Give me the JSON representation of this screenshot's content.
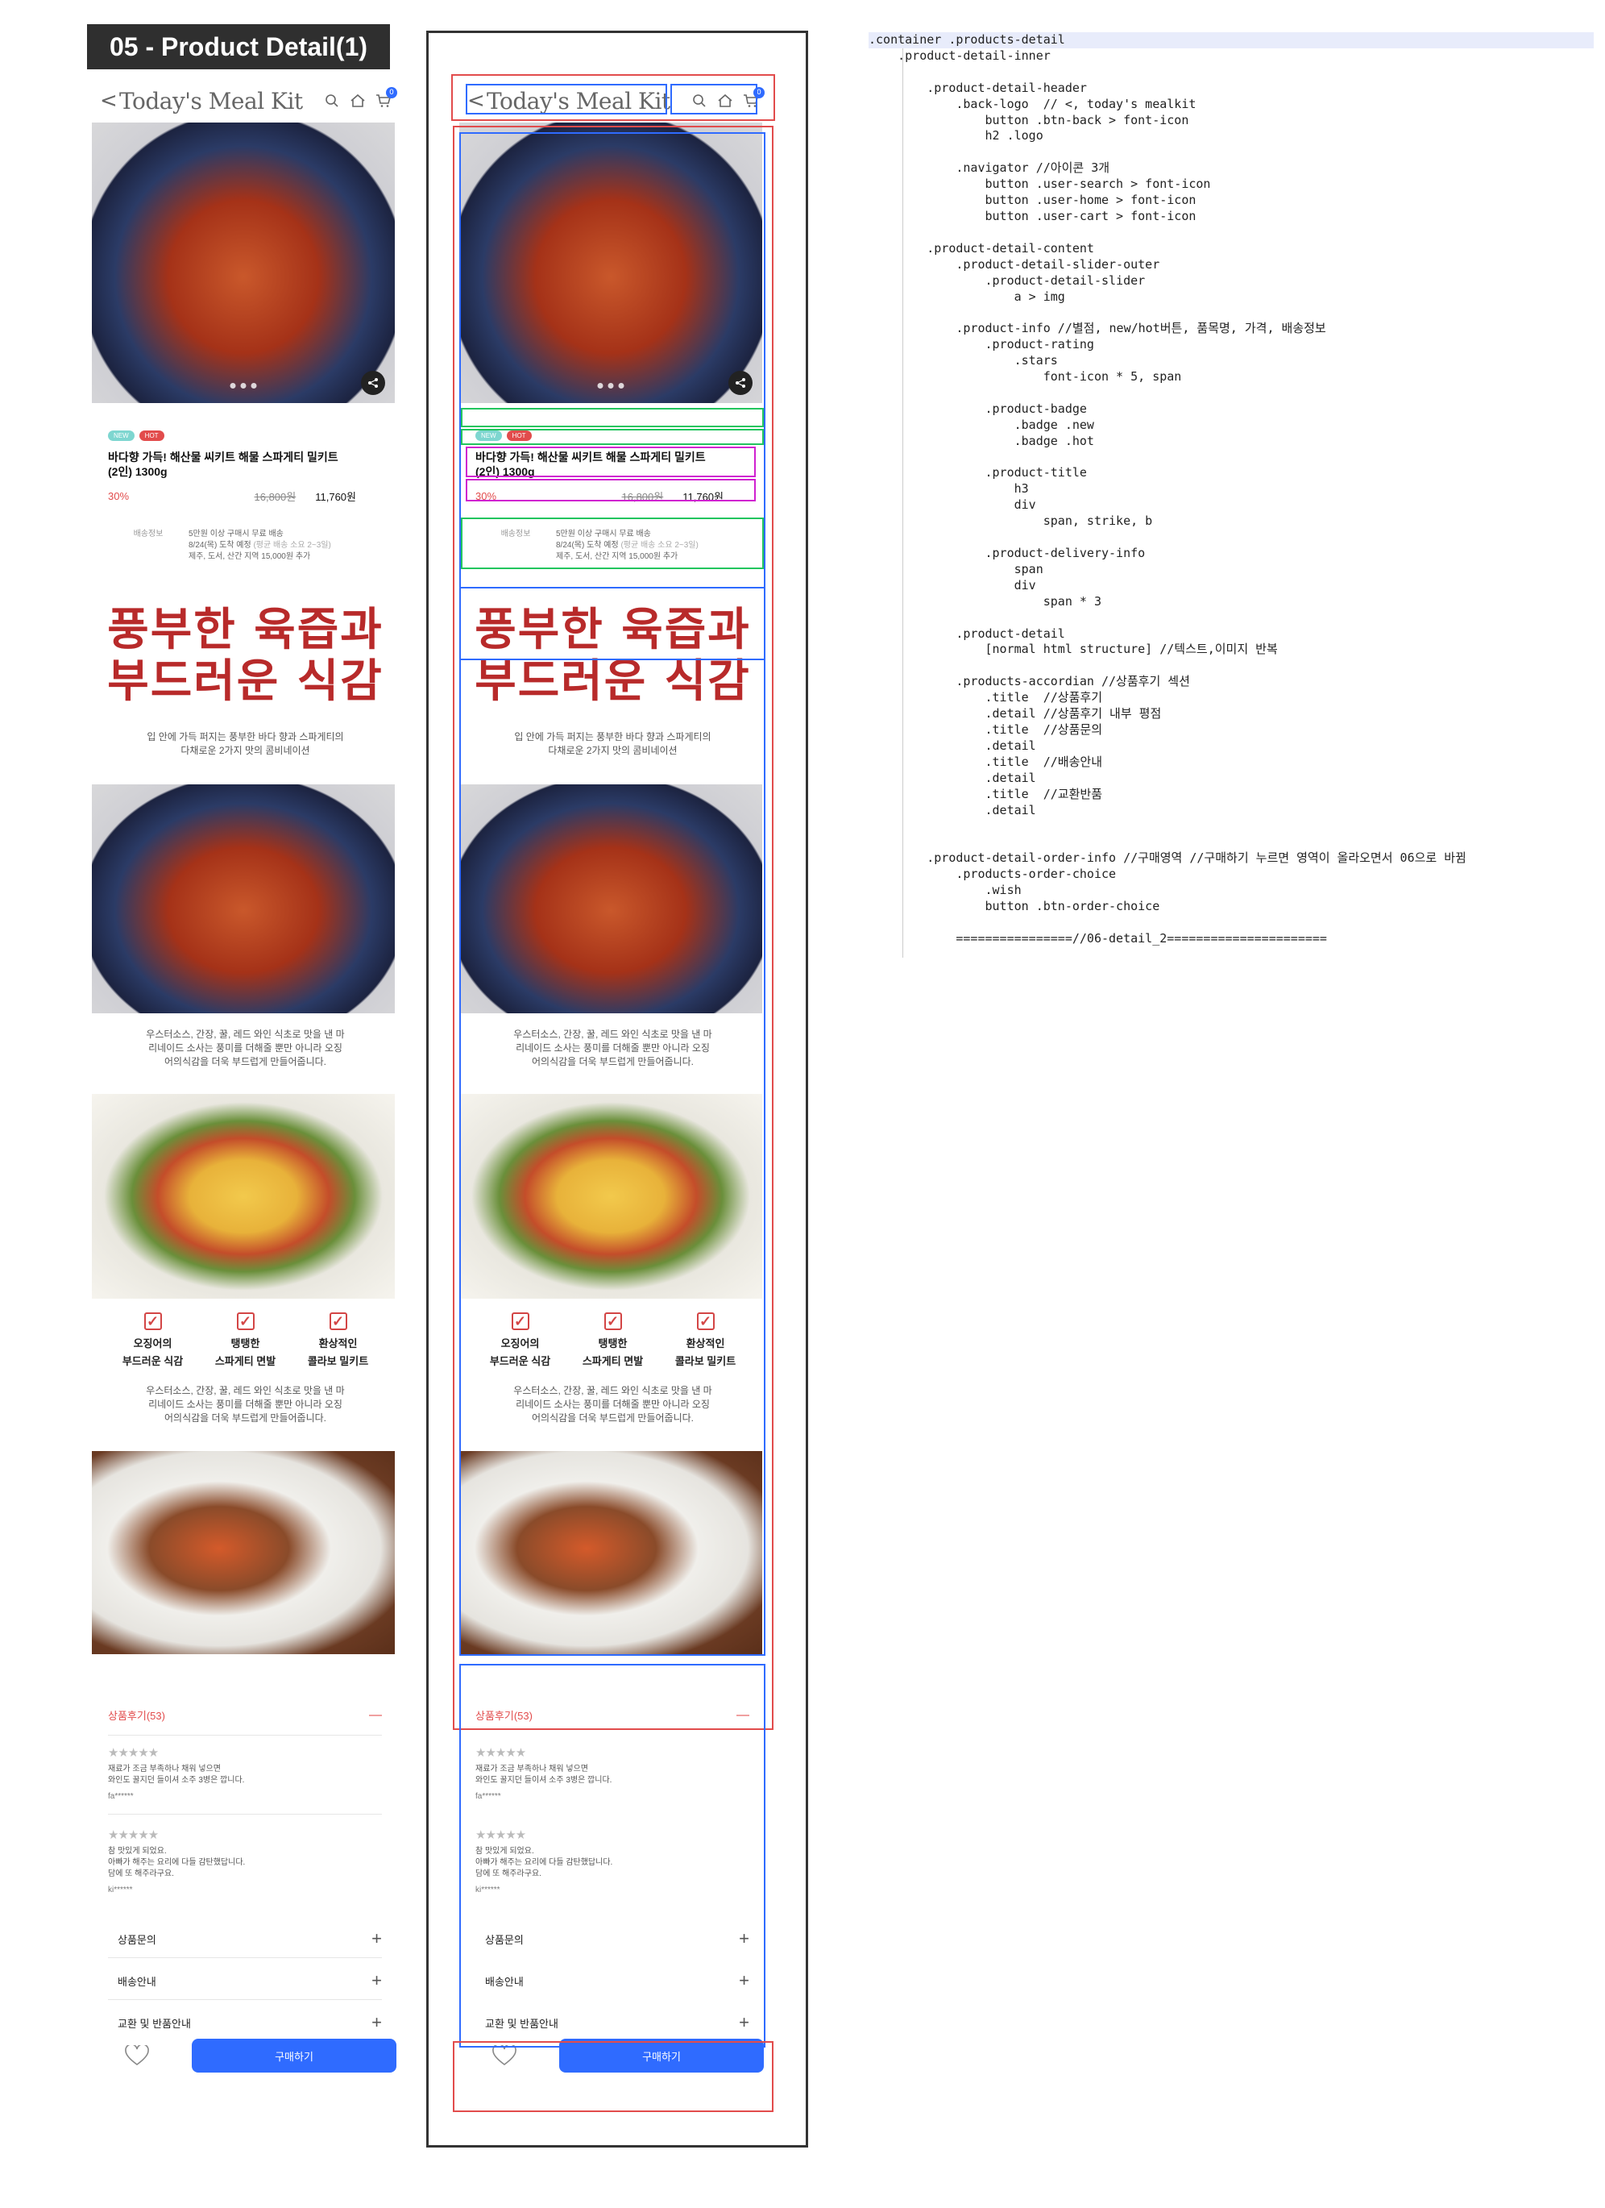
{
  "page_label": "05 - Product Detail(1)",
  "header": {
    "back_icon": "<",
    "logo": "Today's Meal Kit",
    "cart_count": "0"
  },
  "product": {
    "badge_new": "NEW",
    "badge_hot": "HOT",
    "title_line1": "바다향 가득! 해산물 씨키트 해물 스파게티 밀키트",
    "title_line2": "(2인) 1300g",
    "discount_rate": "30%",
    "original_price": "16,800원",
    "sale_price": "11,760원",
    "delivery_label": "배송정보",
    "delivery_line1": "5만원 이상 구매시 무료 배송",
    "delivery_line2a": "8/24(목) 도착 예정",
    "delivery_line2b": "(평균 배송 소요 2~3일)",
    "delivery_line3": "제주, 도서, 산간 지역 15,000원 추가"
  },
  "detail": {
    "headline_line1": "풍부한 육즙과",
    "headline_line2": "부드러운 식감",
    "para1_line1": "입 안에 가득 퍼지는 풍부한 바다 향과 스파게티의",
    "para1_line2": "다채로운 2가지 맛의 콤비네이션",
    "para2_line1": "우스터소스, 간장, 꿀, 레드 와인 식초로 맛을 낸 마",
    "para2_line2": "리네이드 소사는 풍미를 더해줄 뿐만 아니라 오징",
    "para2_line3": "어의식감을 더욱 부드럽게 만들어줍니다.",
    "checks": [
      {
        "line1": "오징어의",
        "line2": "부드러운 식감"
      },
      {
        "line1": "탱탱한",
        "line2": "스파게티 면발"
      },
      {
        "line1": "환상적인",
        "line2": "콜라보 밀키트"
      }
    ],
    "para3_line1": "우스터소스, 간장, 꿀, 레드 와인 식초로 맛을 낸 마",
    "para3_line2": "리네이드 소사는 풍미를 더해줄 뿐만 아니라 오징",
    "para3_line3": "어의식감을 더욱 부드럽게 만들어줍니다."
  },
  "accordion": {
    "reviews_title": "상품후기(53)",
    "reviews_symbol": "—",
    "reviews": [
      {
        "stars": "★★★★★",
        "line1": "재료가 조금 부족하나 채워 넣으면",
        "line2": "와인도 꿀지던 들이셔 소주 3병은 깝니다.",
        "user": "fa******"
      },
      {
        "stars": "★★★★★",
        "line1": "참 맛있게 되었요.",
        "line2": "아빠가 해주는 요리에 다들 감탄했답니다.",
        "line3": "담에 또 해주라구요.",
        "user": "ki******"
      }
    ],
    "qna_title": "상품문의",
    "shipping_title": "배송안내",
    "exchange_title": "교환 및 반품안내",
    "plus_symbol": "+"
  },
  "order": {
    "buy_label": "구매하기"
  },
  "code_lines": [
    ".container .products-detail",
    "    .product-detail-inner",
    "",
    "        .product-detail-header",
    "            .back-logo  // <, today's mealkit",
    "                button .btn-back > font-icon",
    "                h2 .logo",
    "",
    "            .navigator //아이콘 3개",
    "                button .user-search > font-icon",
    "                button .user-home > font-icon",
    "                button .user-cart > font-icon",
    "",
    "        .product-detail-content",
    "            .product-detail-slider-outer",
    "                .product-detail-slider",
    "                    a > img",
    "",
    "            .product-info //별점, new/hot버튼, 품목명, 가격, 배송정보",
    "                .product-rating",
    "                    .stars",
    "                        font-icon * 5, span",
    "",
    "                .product-badge",
    "                    .badge .new",
    "                    .badge .hot",
    "",
    "                .product-title",
    "                    h3",
    "                    div",
    "                        span, strike, b",
    "",
    "                .product-delivery-info",
    "                    span",
    "                    div",
    "                        span * 3",
    "",
    "            .product-detail",
    "                [normal html structure] //텍스트,이미지 반복",
    "",
    "            .products-accordian //상품후기 섹션",
    "                .title  //상품후기",
    "                .detail //상품후기 내부 평점",
    "                .title  //상품문의",
    "                .detail",
    "                .title  //배송안내",
    "                .detail",
    "                .title  //교환반품",
    "                .detail",
    "",
    "",
    "        .product-detail-order-info //구매영역 //구매하기 누르면 영역이 올라오면서 06으로 바뀜",
    "            .products-order-choice",
    "                .wish",
    "                button .btn-order-choice",
    "",
    "            ================//06-detail_2======================"
  ]
}
